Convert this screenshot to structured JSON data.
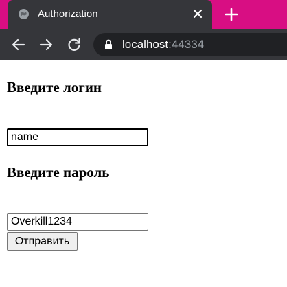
{
  "browser": {
    "tab": {
      "title": "Authorization",
      "favicon": "globe-icon",
      "close_icon": "close-icon"
    },
    "new_tab_icon": "plus-icon",
    "accent_color": "#d80e83",
    "toolbar": {
      "back_icon": "arrow-left-icon",
      "forward_icon": "arrow-right-icon",
      "reload_icon": "reload-icon",
      "lock_icon": "lock-icon",
      "url_host": "localhost",
      "url_port": ":44334"
    }
  },
  "form": {
    "login_heading": "Введите логин",
    "login_value": "name",
    "password_heading": "Введите пароль",
    "password_value": "Overkill1234",
    "submit_label": "Отправить"
  }
}
